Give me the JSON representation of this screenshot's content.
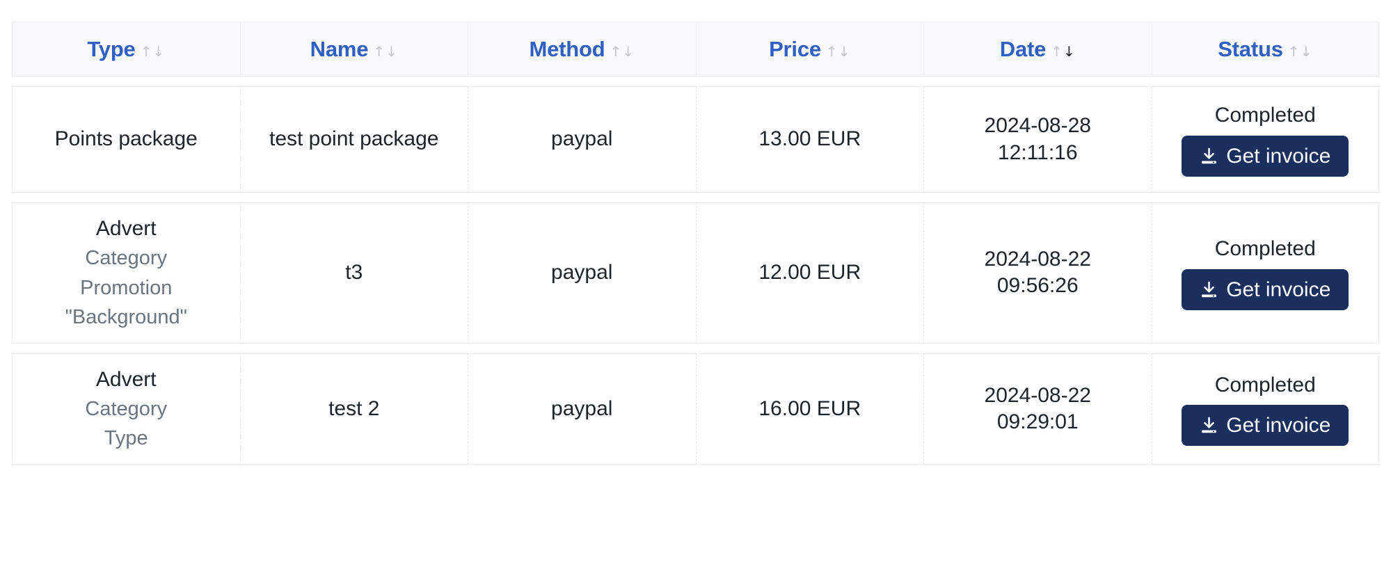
{
  "table": {
    "columns": [
      {
        "label": "Type",
        "sort": "none",
        "sort_icon": "sort-arrows-icon"
      },
      {
        "label": "Name",
        "sort": "none",
        "sort_icon": "sort-arrows-icon"
      },
      {
        "label": "Method",
        "sort": "none",
        "sort_icon": "sort-arrows-icon"
      },
      {
        "label": "Price",
        "sort": "none",
        "sort_icon": "sort-arrows-icon"
      },
      {
        "label": "Date",
        "sort": "desc",
        "sort_icon": "sort-arrows-icon"
      },
      {
        "label": "Status",
        "sort": "none",
        "sort_icon": "sort-arrows-icon"
      }
    ],
    "sort_up_glyph": "↑",
    "sort_down_glyph": "↓",
    "rows": [
      {
        "type_main": "Points package",
        "type_subs": [],
        "name": "test point package",
        "method": "paypal",
        "price": "13.00 EUR",
        "date": "2024-08-28",
        "time": "12:11:16",
        "status": "Completed",
        "action_label": "Get invoice",
        "action_icon": "download-icon"
      },
      {
        "type_main": "Advert",
        "type_subs": [
          "Category",
          "Promotion",
          "\"Background\""
        ],
        "name": "t3",
        "method": "paypal",
        "price": "12.00 EUR",
        "date": "2024-08-22",
        "time": "09:56:26",
        "status": "Completed",
        "action_label": "Get invoice",
        "action_icon": "download-icon"
      },
      {
        "type_main": "Advert",
        "type_subs": [
          "Category",
          "Type"
        ],
        "name": "test 2",
        "method": "paypal",
        "price": "16.00 EUR",
        "date": "2024-08-22",
        "time": "09:29:01",
        "status": "Completed",
        "action_label": "Get invoice",
        "action_icon": "download-icon"
      }
    ]
  },
  "colors": {
    "header_text": "#2f5fc4",
    "header_bg": "#f8f9fa",
    "button_bg": "#1b2f5e",
    "button_text": "#ffffff",
    "muted_text": "#6c757d",
    "body_text": "#1d2328",
    "border": "#e9ecef"
  }
}
